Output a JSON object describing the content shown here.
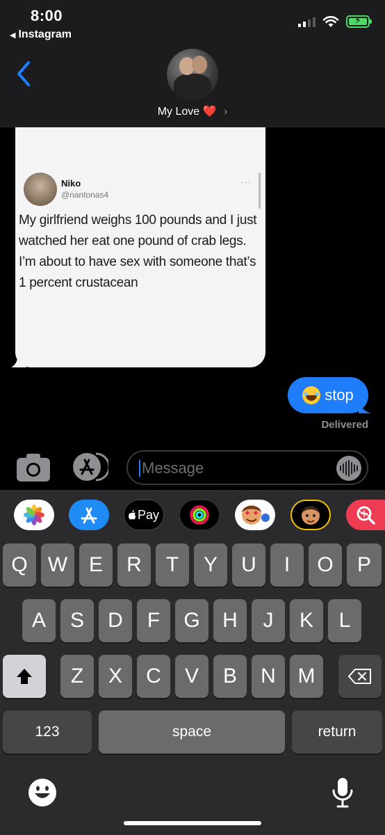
{
  "status_bar": {
    "time": "8:00",
    "back_app_label": "Instagram",
    "battery_charging": true,
    "colors": {
      "battery": "#4cd964"
    }
  },
  "conversation": {
    "contact_name": "My Love",
    "heart_emoji": "❤️",
    "chevron": "›",
    "accent": "#1f7cfb"
  },
  "tweet": {
    "name": "Niko",
    "handle": "@nantonas4",
    "more": "···",
    "text": "My girlfriend weighs 100 pounds and I just watched her eat one pound of crab legs. I’m about to have sex with someone that’s 1 percent crustacean"
  },
  "sent_message": {
    "emoji": "laughing-with-tears",
    "text": "stop",
    "status": "Delivered"
  },
  "input": {
    "placeholder": "Message"
  },
  "app_strip": [
    {
      "icon": "photos-icon"
    },
    {
      "icon": "app-store-icon"
    },
    {
      "icon": "apple-pay-icon",
      "label": "Pay"
    },
    {
      "icon": "activity-icon"
    },
    {
      "icon": "memoji-stickers-icon"
    },
    {
      "icon": "memoji-icon"
    },
    {
      "icon": "search-images-icon"
    }
  ],
  "keyboard": {
    "row1": [
      "Q",
      "W",
      "E",
      "R",
      "T",
      "Y",
      "U",
      "I",
      "O",
      "P"
    ],
    "row2": [
      "A",
      "S",
      "D",
      "F",
      "G",
      "H",
      "J",
      "K",
      "L"
    ],
    "row3": [
      "Z",
      "X",
      "C",
      "V",
      "B",
      "N",
      "M"
    ],
    "numbers": "123",
    "space": "space",
    "return": "return"
  }
}
